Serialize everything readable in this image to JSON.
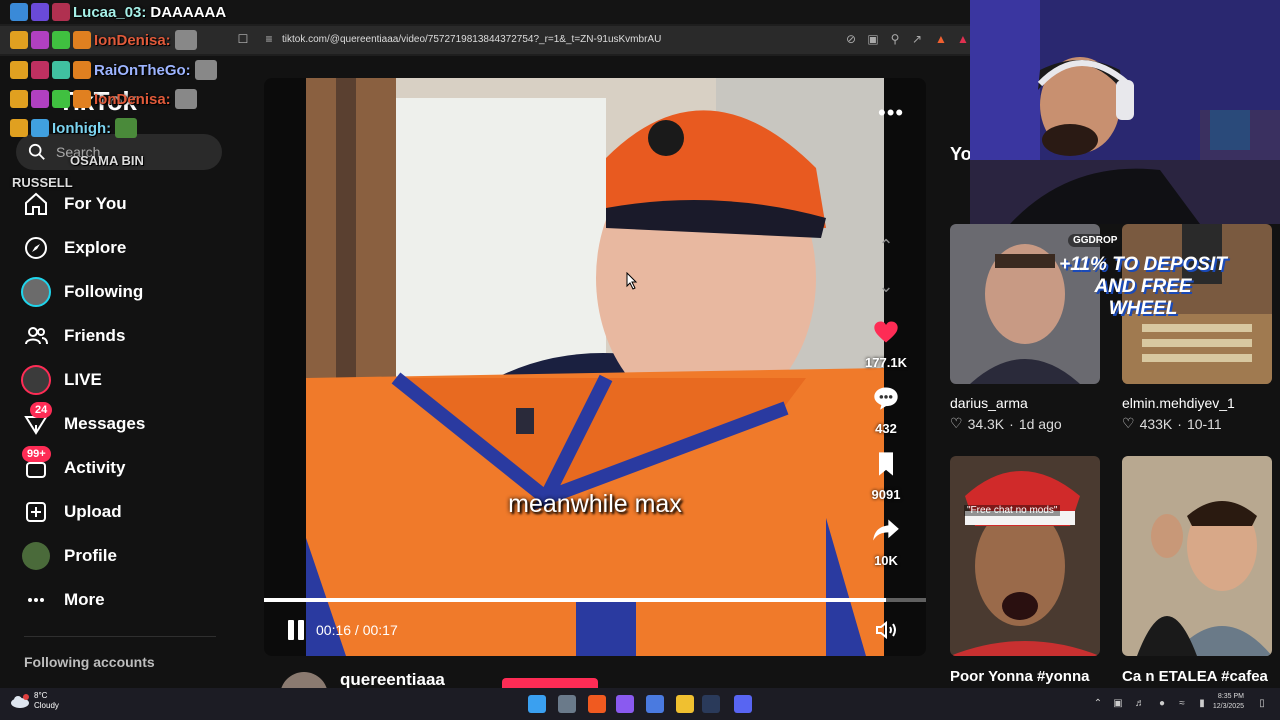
{
  "browser": {
    "url": "tiktok.com/@quereentiaaa/video/7572719813844372754?_r=1&_t=ZN-91usKvmbrAU"
  },
  "sidebar": {
    "logo": "TikTok",
    "search_placeholder": "Search",
    "items": [
      {
        "label": "For You"
      },
      {
        "label": "Explore"
      },
      {
        "label": "Following"
      },
      {
        "label": "Friends"
      },
      {
        "label": "LIVE"
      },
      {
        "label": "Messages",
        "badge": "24"
      },
      {
        "label": "Activity",
        "badge": "99+"
      },
      {
        "label": "Upload"
      },
      {
        "label": "Profile"
      },
      {
        "label": "More"
      }
    ],
    "following_accounts_title": "Following accounts"
  },
  "chat": [
    {
      "name": "Lucaa_03:",
      "message": "DAAAAAA",
      "color": "#a6f0e8"
    },
    {
      "name": "IonDenisa:",
      "message": "",
      "color": "#e05a3a"
    },
    {
      "name": "RaiOnTheGo:",
      "message": "",
      "color": "#9db4ff"
    },
    {
      "name": "IonDenisa:",
      "message": "",
      "color": "#e05a3a"
    },
    {
      "name": "Ionhigh:",
      "message": "",
      "color": "#7cd4f0"
    },
    {
      "name": "",
      "message": "OSAMA BIN",
      "color": "#ffffff"
    },
    {
      "name": "",
      "message": "RUSSELL",
      "color": "#ffffff"
    }
  ],
  "video": {
    "caption": "meanwhile max",
    "current_time": "00:16",
    "duration": "00:17",
    "time_display": "00:16 / 00:17",
    "progress_fraction": 0.94,
    "actions": {
      "likes": "177.1K",
      "comments": "432",
      "saves": "9091",
      "shares": "10K"
    },
    "author": "quereentiaaa"
  },
  "recommendations": {
    "heading": "Yo",
    "videos": [
      {
        "author": "darius_arma",
        "likes": "34.3K",
        "age": "1d ago",
        "title": ""
      },
      {
        "author": "elmin.mehdiyev_1",
        "likes": "433K",
        "age": "10-11",
        "title": "",
        "ad_brand": "GGDROP",
        "ad_text": "+11% TO DEPOSIT AND FREE WHEEL"
      },
      {
        "author": "",
        "likes": "",
        "age": "",
        "title": "Poor Yonna #yonna",
        "overlay_text": "\"Free chat no mods\""
      },
      {
        "author": "",
        "likes": "",
        "age": "",
        "title": "Ca n ETALEA #cafea"
      }
    ]
  },
  "taskbar": {
    "temperature": "8°C",
    "condition": "Cloudy",
    "time": "8:35 PM",
    "date": "12/3/2025"
  },
  "colors": {
    "accent": "#fe2c55",
    "cyan": "#20d5ec",
    "background": "#121212"
  }
}
